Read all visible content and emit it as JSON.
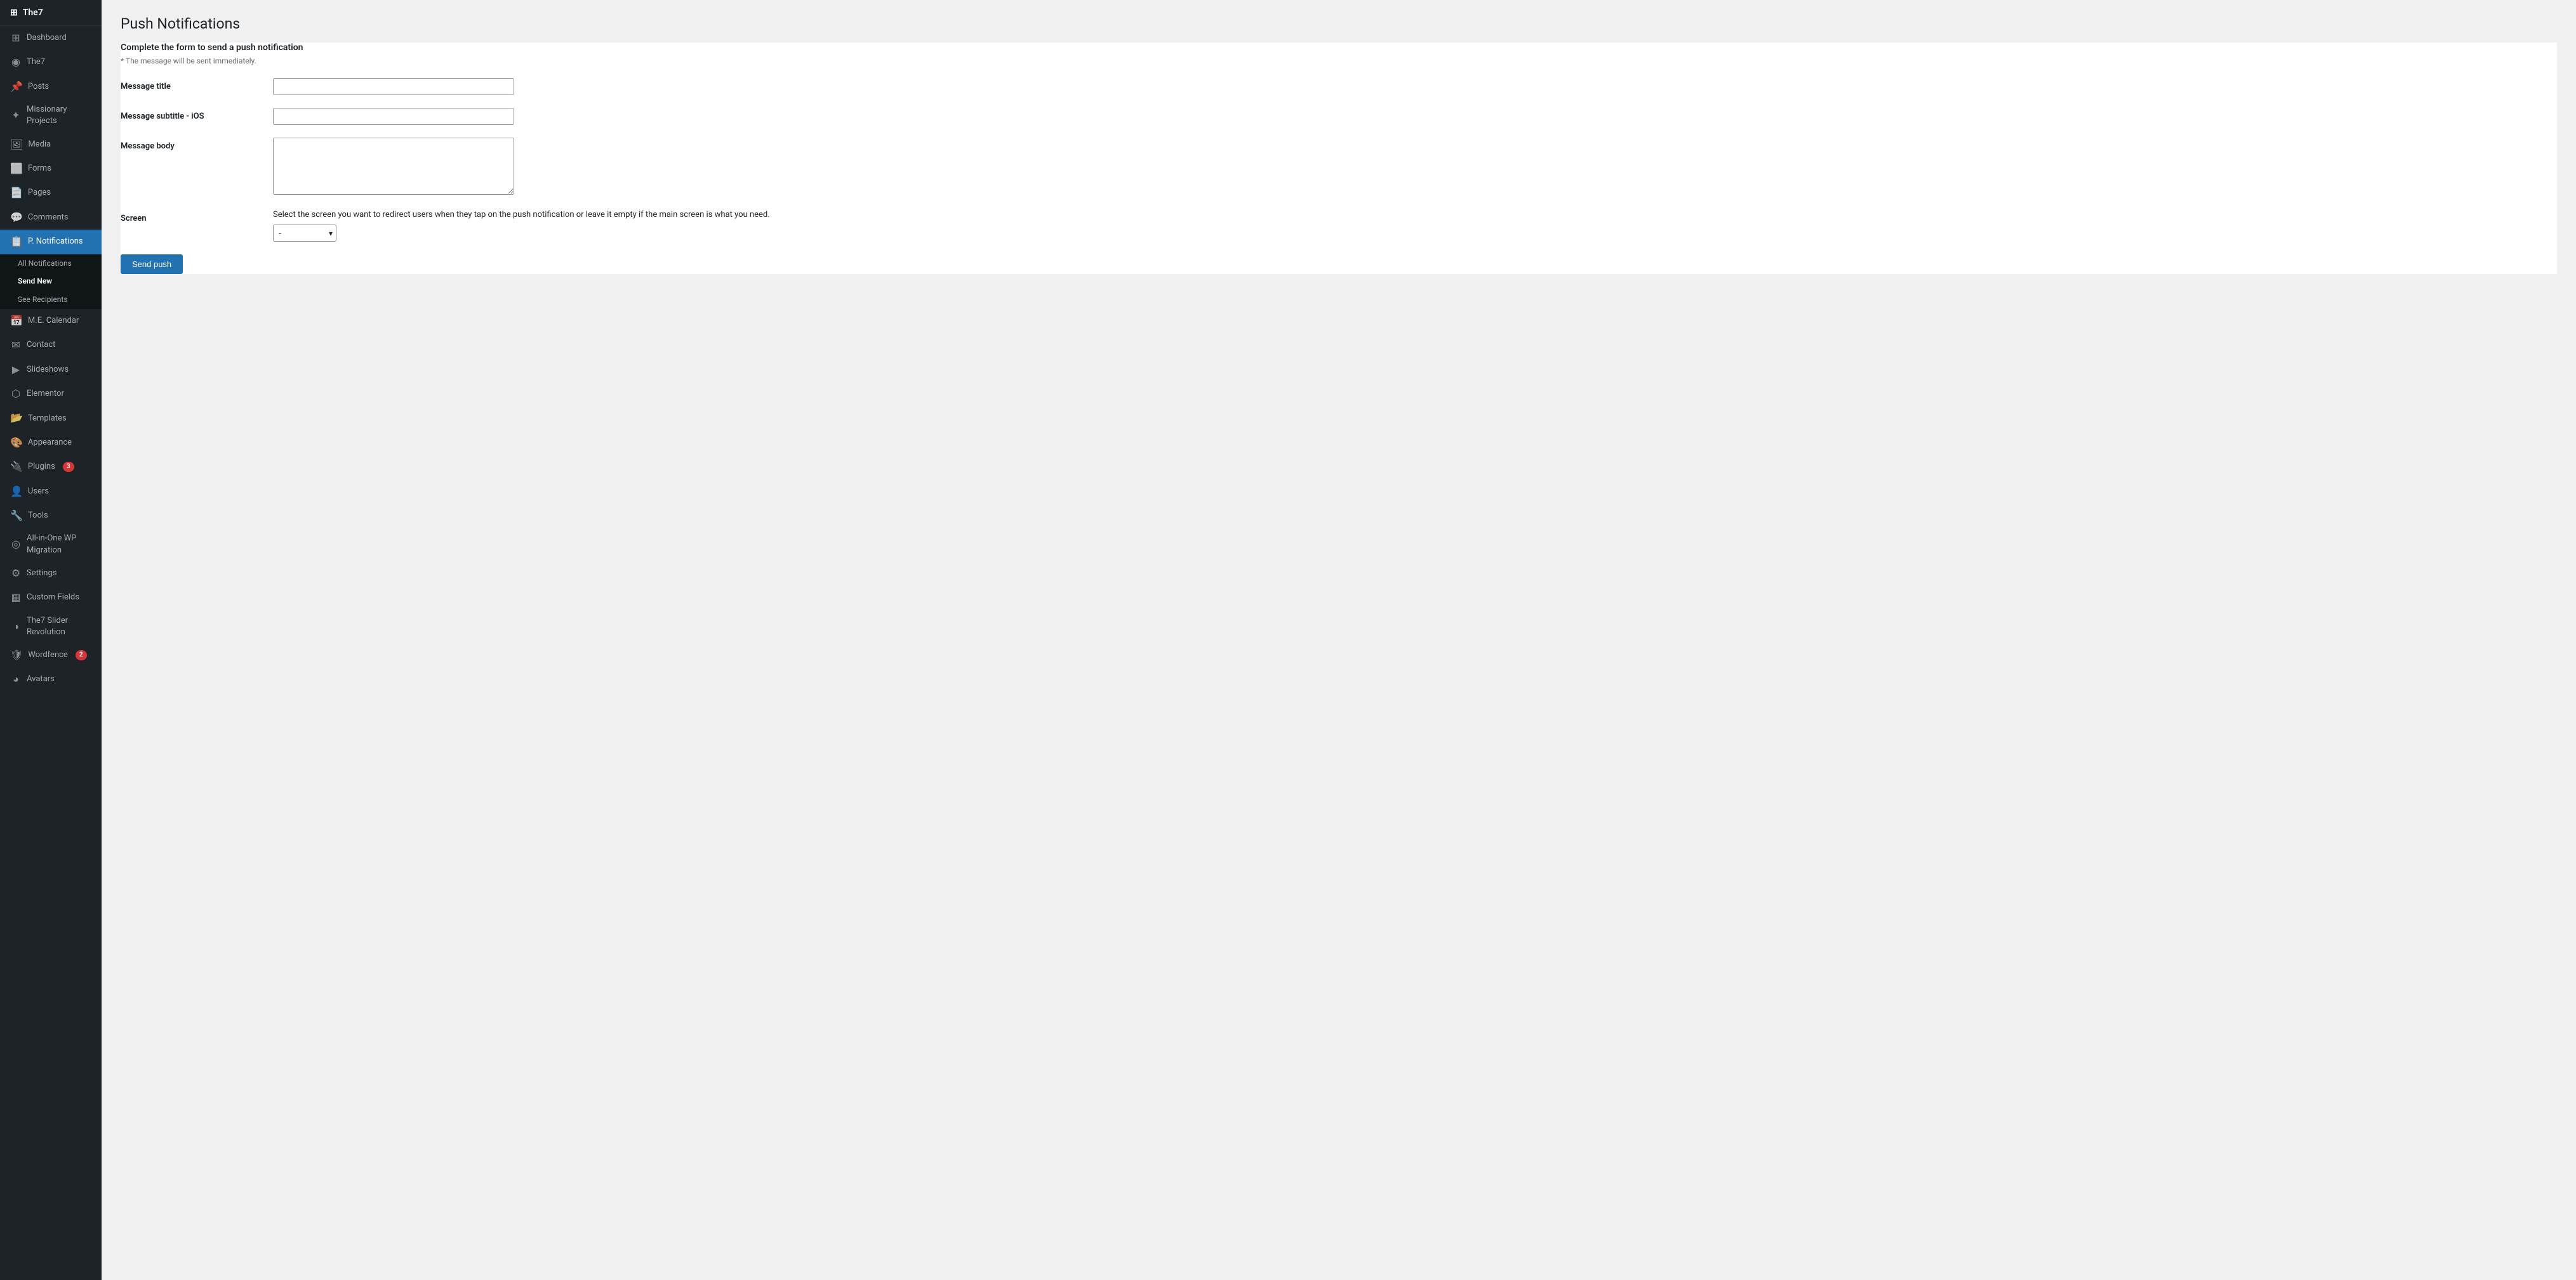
{
  "sidebar": {
    "logo": "The7",
    "items": [
      {
        "id": "dashboard",
        "label": "Dashboard",
        "icon": "⊞",
        "active": false
      },
      {
        "id": "the7",
        "label": "The7",
        "icon": "◉",
        "active": false
      },
      {
        "id": "posts",
        "label": "Posts",
        "icon": "📌",
        "active": false
      },
      {
        "id": "missionary-projects",
        "label": "Missionary Projects",
        "icon": "✦",
        "active": false
      },
      {
        "id": "media",
        "label": "Media",
        "icon": "🖼",
        "active": false
      },
      {
        "id": "forms",
        "label": "Forms",
        "icon": "⬜",
        "active": false
      },
      {
        "id": "pages",
        "label": "Pages",
        "icon": "📄",
        "active": false
      },
      {
        "id": "comments",
        "label": "Comments",
        "icon": "💬",
        "active": false
      },
      {
        "id": "p-notifications",
        "label": "P. Notifications",
        "icon": "📋",
        "active": true
      },
      {
        "id": "me-calendar",
        "label": "M.E. Calendar",
        "icon": "📅",
        "active": false
      },
      {
        "id": "contact",
        "label": "Contact",
        "icon": "✉",
        "active": false
      },
      {
        "id": "slideshows",
        "label": "Slideshows",
        "icon": "▶",
        "active": false
      },
      {
        "id": "elementor",
        "label": "Elementor",
        "icon": "⬡",
        "active": false
      },
      {
        "id": "templates",
        "label": "Templates",
        "icon": "📂",
        "active": false
      },
      {
        "id": "appearance",
        "label": "Appearance",
        "icon": "🎨",
        "active": false
      },
      {
        "id": "plugins",
        "label": "Plugins",
        "icon": "🔌",
        "active": false,
        "badge": "3"
      },
      {
        "id": "users",
        "label": "Users",
        "icon": "👤",
        "active": false
      },
      {
        "id": "tools",
        "label": "Tools",
        "icon": "🔧",
        "active": false
      },
      {
        "id": "all-in-one-wp-migration",
        "label": "All-in-One WP Migration",
        "icon": "◎",
        "active": false
      },
      {
        "id": "settings",
        "label": "Settings",
        "icon": "⚙",
        "active": false
      },
      {
        "id": "custom-fields",
        "label": "Custom Fields",
        "icon": "▦",
        "active": false
      },
      {
        "id": "the7-slider-revolution",
        "label": "The7 Slider Revolution",
        "icon": "◑",
        "active": false
      },
      {
        "id": "wordfence",
        "label": "Wordfence",
        "icon": "🛡",
        "active": false,
        "badge": "2"
      },
      {
        "id": "avatars",
        "label": "Avatars",
        "icon": "◕",
        "active": false
      }
    ],
    "submenu": {
      "items": [
        {
          "id": "all-notifications",
          "label": "All Notifications",
          "current": false
        },
        {
          "id": "send-new",
          "label": "Send New",
          "current": true
        },
        {
          "id": "see-recipients",
          "label": "See Recipients",
          "current": false
        }
      ]
    }
  },
  "main": {
    "page_title": "Push Notifications",
    "form": {
      "section_title": "Complete the form to send a push notification",
      "note": "* The message will be sent immediately.",
      "fields": {
        "message_title": {
          "label": "Message title",
          "placeholder": "",
          "value": ""
        },
        "message_subtitle": {
          "label": "Message subtitle - iOS",
          "placeholder": "",
          "value": ""
        },
        "message_body": {
          "label": "Message body",
          "placeholder": "",
          "value": ""
        },
        "screen": {
          "label": "Screen",
          "note": "Select the screen you want to redirect users when they tap on the push notification or leave it empty if the main screen is what you need.",
          "default_option": "-",
          "options": [
            "-"
          ]
        }
      },
      "submit_button": "Send push"
    }
  }
}
